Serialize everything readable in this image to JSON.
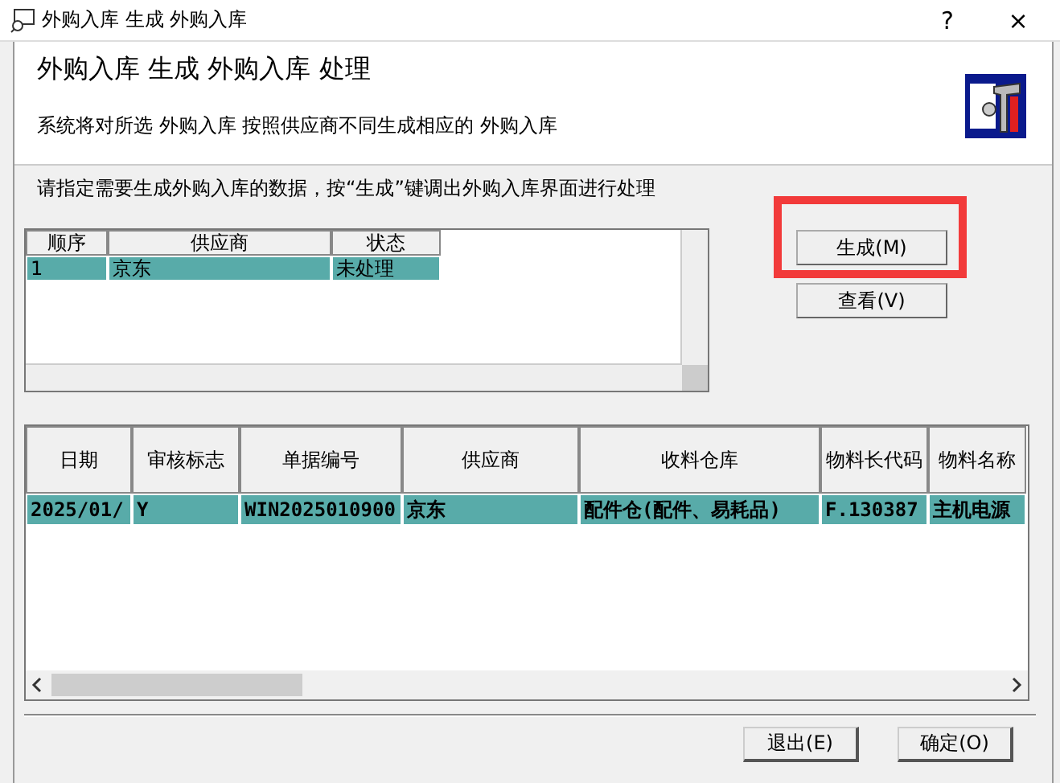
{
  "window": {
    "title": "外购入库 生成 外购入库",
    "help": "?",
    "close": "×"
  },
  "header": {
    "title": "外购入库 生成 外购入库 处理",
    "description": "系统将对所选 外购入库 按照供应商不同生成相应的 外购入库"
  },
  "instruction": "请指定需要生成外购入库的数据，按“生成”键调出外购入库界面进行处理",
  "supplier_grid": {
    "columns": [
      "顺序",
      "供应商",
      "状态"
    ],
    "rows": [
      {
        "cells": [
          "1",
          "京东",
          "未处理"
        ],
        "selected": true
      }
    ]
  },
  "side_buttons": [
    {
      "label": "生成(M)",
      "highlighted": true
    },
    {
      "label": "查看(V)",
      "highlighted": false
    }
  ],
  "detail_grid": {
    "columns": [
      "日期",
      "审核标志",
      "单据编号",
      "供应商",
      "收料仓库",
      "物料长代码",
      "物料名称"
    ],
    "rows": [
      {
        "cells": [
          "2025/01/",
          "Y",
          "WIN2025010900",
          "京东",
          "配件仓(配件、易耗品)",
          "F.130387",
          "主机电源"
        ],
        "selected": true
      }
    ]
  },
  "footer_buttons": [
    "退出(E)",
    "确定(O)"
  ]
}
